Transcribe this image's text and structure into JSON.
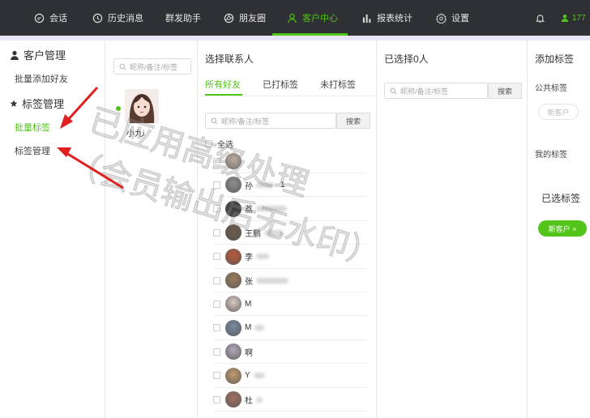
{
  "topnav": {
    "items": [
      {
        "label": "会话",
        "icon": "chat-icon"
      },
      {
        "label": "历史消息",
        "icon": "clock-icon"
      },
      {
        "label": "群发助手",
        "icon": ""
      },
      {
        "label": "朋友圈",
        "icon": "aperture-icon"
      },
      {
        "label": "客户中心",
        "icon": "user-icon",
        "active": true
      },
      {
        "label": "报表统计",
        "icon": "bar-chart-icon"
      },
      {
        "label": "设置",
        "icon": "gear-icon"
      }
    ],
    "user_number": "177",
    "accent": "#52c41a",
    "bg": "#2f3033"
  },
  "sidebar": {
    "group1_title": "客户管理",
    "group1_items": [
      "批量添加好友"
    ],
    "group2_title": "标签管理",
    "group2_items": [
      "批量标签",
      "标签管理"
    ]
  },
  "panel_friends": {
    "search_placeholder": "昵称/备注/标签",
    "selected_name": "小九i"
  },
  "panel_contacts": {
    "title": "选择联系人",
    "tabs": [
      "所有好友",
      "已打标签",
      "未打标签"
    ],
    "search_placeholder": "昵称/备注/标签",
    "search_button": "搜索",
    "select_all": "全选",
    "rows": [
      {
        "name": ""
      },
      {
        "name": "孙",
        "suffix": "1"
      },
      {
        "name": "荔"
      },
      {
        "name": "王鹏"
      },
      {
        "name": "李"
      },
      {
        "name": "张"
      },
      {
        "name": "M"
      },
      {
        "name": "M"
      },
      {
        "name": "啊"
      },
      {
        "name": "Y"
      },
      {
        "name": "杜"
      }
    ]
  },
  "panel_selected": {
    "title": "已选择0人",
    "search_placeholder": "昵称/备注/标签",
    "search_button": "搜索"
  },
  "panel_tags": {
    "title": "添加标签",
    "public_tags_label": "公共标签",
    "public_tag_chip": "新客户",
    "my_tags_label": "我的标签",
    "selected_tags_label": "已选标签",
    "selected_tag_chip": "新客户 ×"
  },
  "watermark": {
    "line1": "已应用高级处理",
    "line2": "（会员输出后无水印）"
  }
}
